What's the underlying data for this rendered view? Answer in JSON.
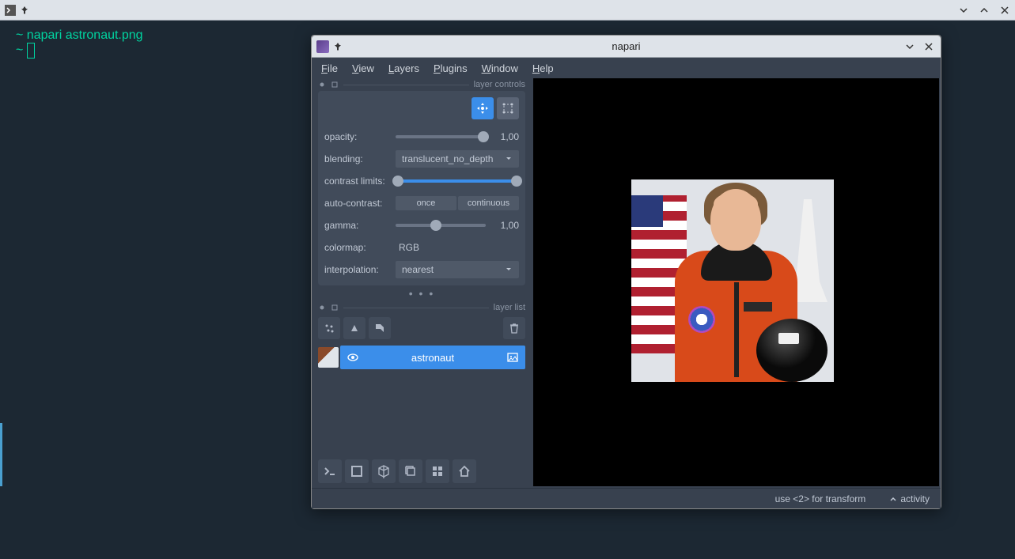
{
  "outer": {
    "terminal_line1_prompt": "~",
    "terminal_line1_cmd": "napari astronaut.png",
    "terminal_line2_prompt": "~"
  },
  "napari": {
    "title": "napari",
    "menu": {
      "file": "File",
      "view": "View",
      "layers": "Layers",
      "plugins": "Plugins",
      "window": "Window",
      "help": "Help"
    },
    "sections": {
      "layer_controls": "layer controls",
      "layer_list": "layer list"
    },
    "controls": {
      "opacity_label": "opacity:",
      "opacity_value": "1,00",
      "blending_label": "blending:",
      "blending_value": "translucent_no_depth",
      "contrast_label": "contrast limits:",
      "autocontrast_label": "auto-contrast:",
      "once": "once",
      "continuous": "continuous",
      "gamma_label": "gamma:",
      "gamma_value": "1,00",
      "colormap_label": "colormap:",
      "colormap_value": "RGB",
      "interpolation_label": "interpolation:",
      "interpolation_value": "nearest"
    },
    "layer": {
      "name": "astronaut"
    },
    "status": {
      "hint": "use <2> for transform",
      "activity": "activity"
    }
  }
}
